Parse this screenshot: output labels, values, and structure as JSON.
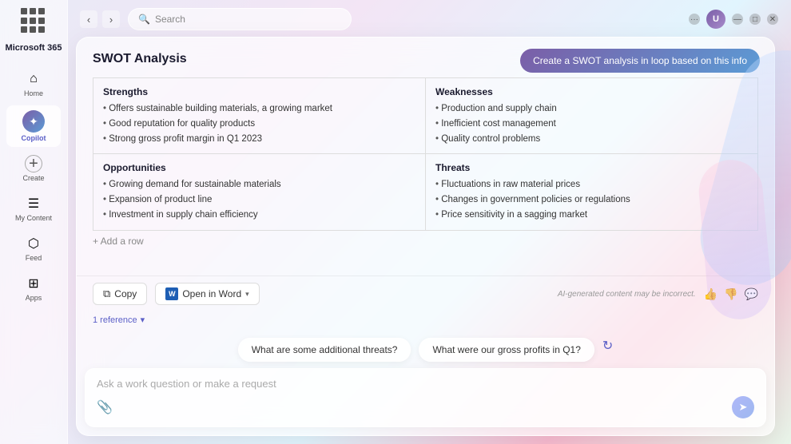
{
  "app": {
    "title": "Microsoft 365",
    "search_placeholder": "Search"
  },
  "window_chrome": {
    "dots_label": "...",
    "minimize": "—",
    "maximize": "□",
    "close": "✕"
  },
  "sidebar": {
    "grid_icon_label": "apps-grid",
    "items": [
      {
        "id": "home",
        "label": "Home",
        "icon": "⌂",
        "active": false
      },
      {
        "id": "copilot",
        "label": "Copilot",
        "icon": "✦",
        "active": true
      },
      {
        "id": "create",
        "label": "Create",
        "icon": "+",
        "active": false
      },
      {
        "id": "my-content",
        "label": "My Content",
        "icon": "☰",
        "active": false
      },
      {
        "id": "feed",
        "label": "Feed",
        "icon": "⬡",
        "active": false
      },
      {
        "id": "apps",
        "label": "Apps",
        "icon": "⊞",
        "active": false
      }
    ]
  },
  "swot_button": {
    "label": "Create a SWOT analysis in loop based on this info"
  },
  "swot": {
    "title": "SWOT Analysis",
    "quadrants": [
      {
        "id": "strengths",
        "heading": "Strengths",
        "items": [
          "Offers sustainable building materials, a growing market",
          "Good reputation for quality products",
          "Strong gross profit margin in Q1 2023"
        ]
      },
      {
        "id": "weaknesses",
        "heading": "Weaknesses",
        "items": [
          "Production and supply chain",
          "Inefficient cost management",
          "Quality control problems"
        ]
      },
      {
        "id": "opportunities",
        "heading": "Opportunities",
        "items": [
          "Growing demand for sustainable materials",
          "Expansion of product line",
          "Investment in supply chain efficiency"
        ]
      },
      {
        "id": "threats",
        "heading": "Threats",
        "items": [
          "Fluctuations in raw material prices",
          "Changes in government policies or regulations",
          "Price sensitivity in a sagging market"
        ]
      }
    ],
    "add_row_label": "+ Add a row"
  },
  "actions": {
    "copy_label": "Copy",
    "open_word_label": "Open in Word",
    "ai_disclaimer": "AI-generated content may be incorrect.",
    "reference_label": "1 reference",
    "reference_icon": "▾"
  },
  "suggestions": [
    {
      "id": "threats",
      "label": "What are some additional threats?"
    },
    {
      "id": "profits",
      "label": "What were our gross profits in Q1?"
    }
  ],
  "input": {
    "placeholder": "Ask a work question or make a request"
  }
}
